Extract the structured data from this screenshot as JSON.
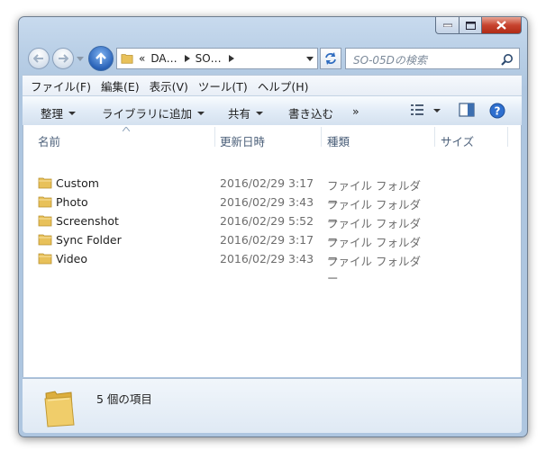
{
  "address": {
    "segments": [
      "«",
      "DA…",
      "SO…"
    ]
  },
  "search": {
    "placeholder": "SO-05Dの検索"
  },
  "menu": [
    "ファイル(F)",
    "編集(E)",
    "表示(V)",
    "ツール(T)",
    "ヘルプ(H)"
  ],
  "toolbar": {
    "organize": "整理",
    "add_to_library": "ライブラリに追加",
    "share": "共有",
    "burn": "書き込む",
    "more": "»"
  },
  "columns": {
    "name": "名前",
    "date": "更新日時",
    "type": "種類",
    "size": "サイズ"
  },
  "files": [
    {
      "name": "Custom",
      "date": "2016/02/29 3:17",
      "type": "ファイル フォルダー"
    },
    {
      "name": "Photo",
      "date": "2016/02/29 3:43",
      "type": "ファイル フォルダー"
    },
    {
      "name": "Screenshot",
      "date": "2016/02/29 5:52",
      "type": "ファイル フォルダー"
    },
    {
      "name": "Sync Folder",
      "date": "2016/02/29 3:17",
      "type": "ファイル フォルダー"
    },
    {
      "name": "Video",
      "date": "2016/02/29 3:43",
      "type": "ファイル フォルダー"
    }
  ],
  "details": {
    "item_count": "5 個の項目"
  },
  "colors": {
    "folder": "#e8c15a",
    "accent": "#2a63b8",
    "close": "#c7432e"
  }
}
